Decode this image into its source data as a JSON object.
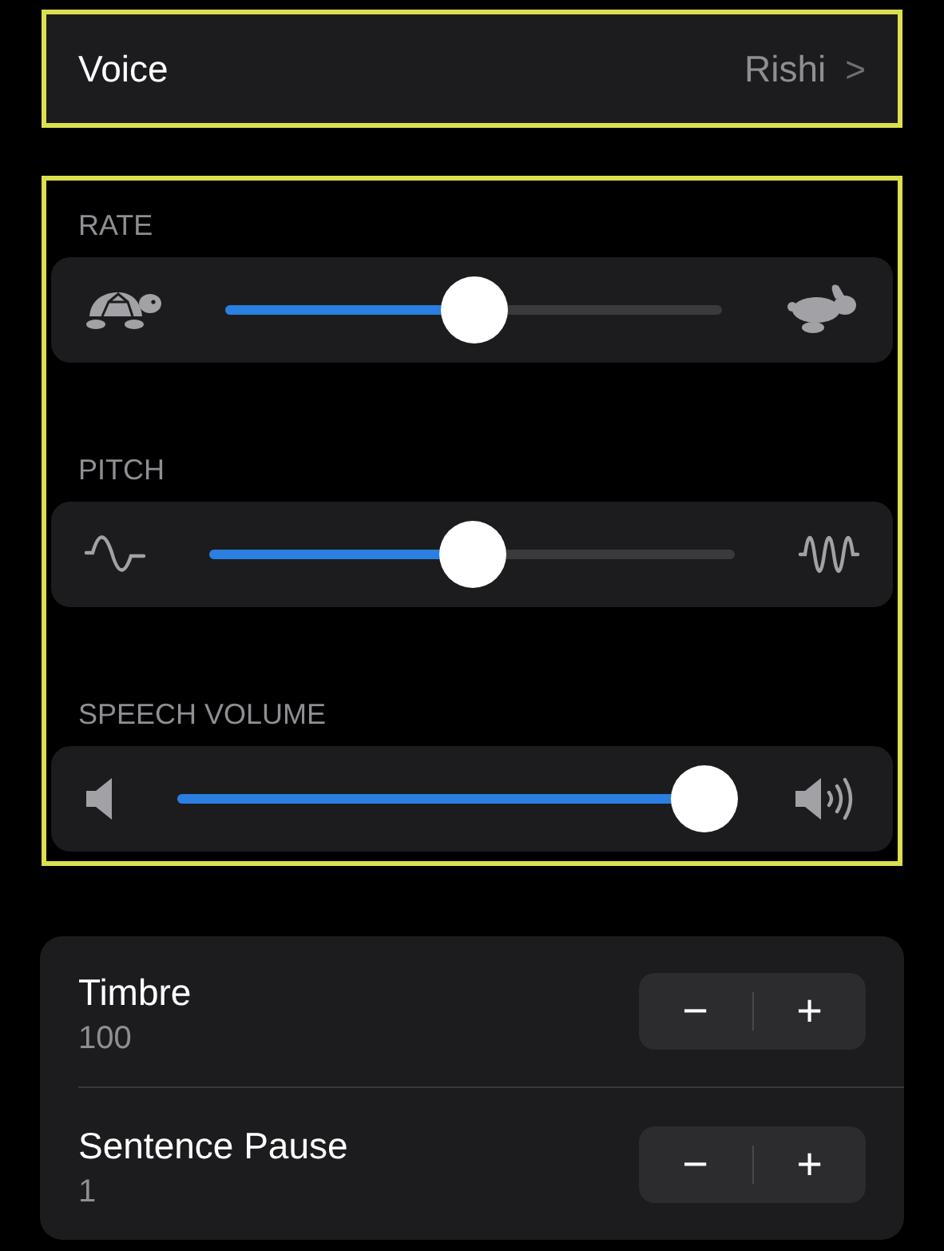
{
  "voice": {
    "label": "Voice",
    "value": "Rishi",
    "chevron": ">"
  },
  "sliders": [
    {
      "label": "RATE",
      "kind": "rate",
      "level": 0.5
    },
    {
      "label": "PITCH",
      "kind": "pitch",
      "level": 0.5
    },
    {
      "label": "SPEECH VOLUME",
      "kind": "volume",
      "level": 0.95
    }
  ],
  "steppers": [
    {
      "label": "Timbre",
      "value": "100",
      "minus": "−",
      "plus": "+"
    },
    {
      "label": "Sentence Pause",
      "value": "1",
      "minus": "−",
      "plus": "+"
    }
  ]
}
